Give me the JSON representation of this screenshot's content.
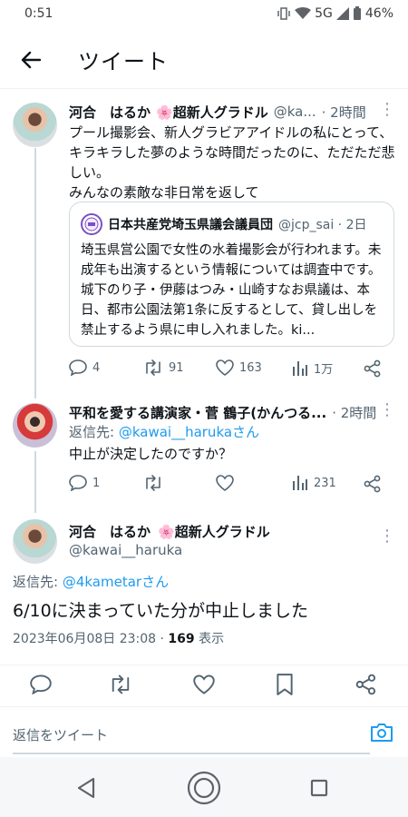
{
  "status_bar": {
    "time": "0:51",
    "network": "5G",
    "battery": "46%"
  },
  "header": {
    "title": "ツイート"
  },
  "tweet1": {
    "name": "河合　はるか",
    "badge": "🌸超新人グラドル",
    "handle": "@ka...",
    "time": "· 2時間",
    "text": "プール撮影会、新人グラビアアイドルの私にとって、キラキラした夢のような時間だったのに、ただただ悲しい。\nみんなの素敵な非日常を返して",
    "quote": {
      "name": "日本共産党埼玉県議会議員団",
      "handle": "@jcp_sai · 2日",
      "text": "埼玉県営公園で女性の水着撮影会が行われます。未成年も出演するという情報については調査中です。城下のり子・伊藤はつみ・山崎すなお県議は、本日、都市公園法第1条に反するとして、貸し出しを禁止するよう県に申し入れました。ki..."
    },
    "stats": {
      "replies": "4",
      "retweets": "91",
      "likes": "163",
      "views": "1万"
    }
  },
  "tweet2": {
    "name": "平和を愛する講演家・菅 鶴子(かんつる...",
    "time": "· 2時間",
    "reply_prefix": "返信先: ",
    "reply_to": "@kawai__harukaさん",
    "text": "中止が決定したのですか？",
    "stats": {
      "replies": "1",
      "retweets": "",
      "likes": "",
      "views": "231"
    }
  },
  "main_tweet": {
    "name": "河合　はるか",
    "badge": "🌸超新人グラドル",
    "handle": "@kawai__haruka",
    "reply_prefix": "返信先: ",
    "reply_to": "@4kametarさん",
    "text": "6/10に決まっていた分が中止しました",
    "datetime": "2023年06月08日 23:08 · ",
    "views": "169",
    "views_label": " 表示"
  },
  "reply_bar": {
    "placeholder": "返信をツイート"
  },
  "colors": {
    "accent": "#1d9bf0",
    "text": "#0f1419",
    "muted": "#536471"
  }
}
